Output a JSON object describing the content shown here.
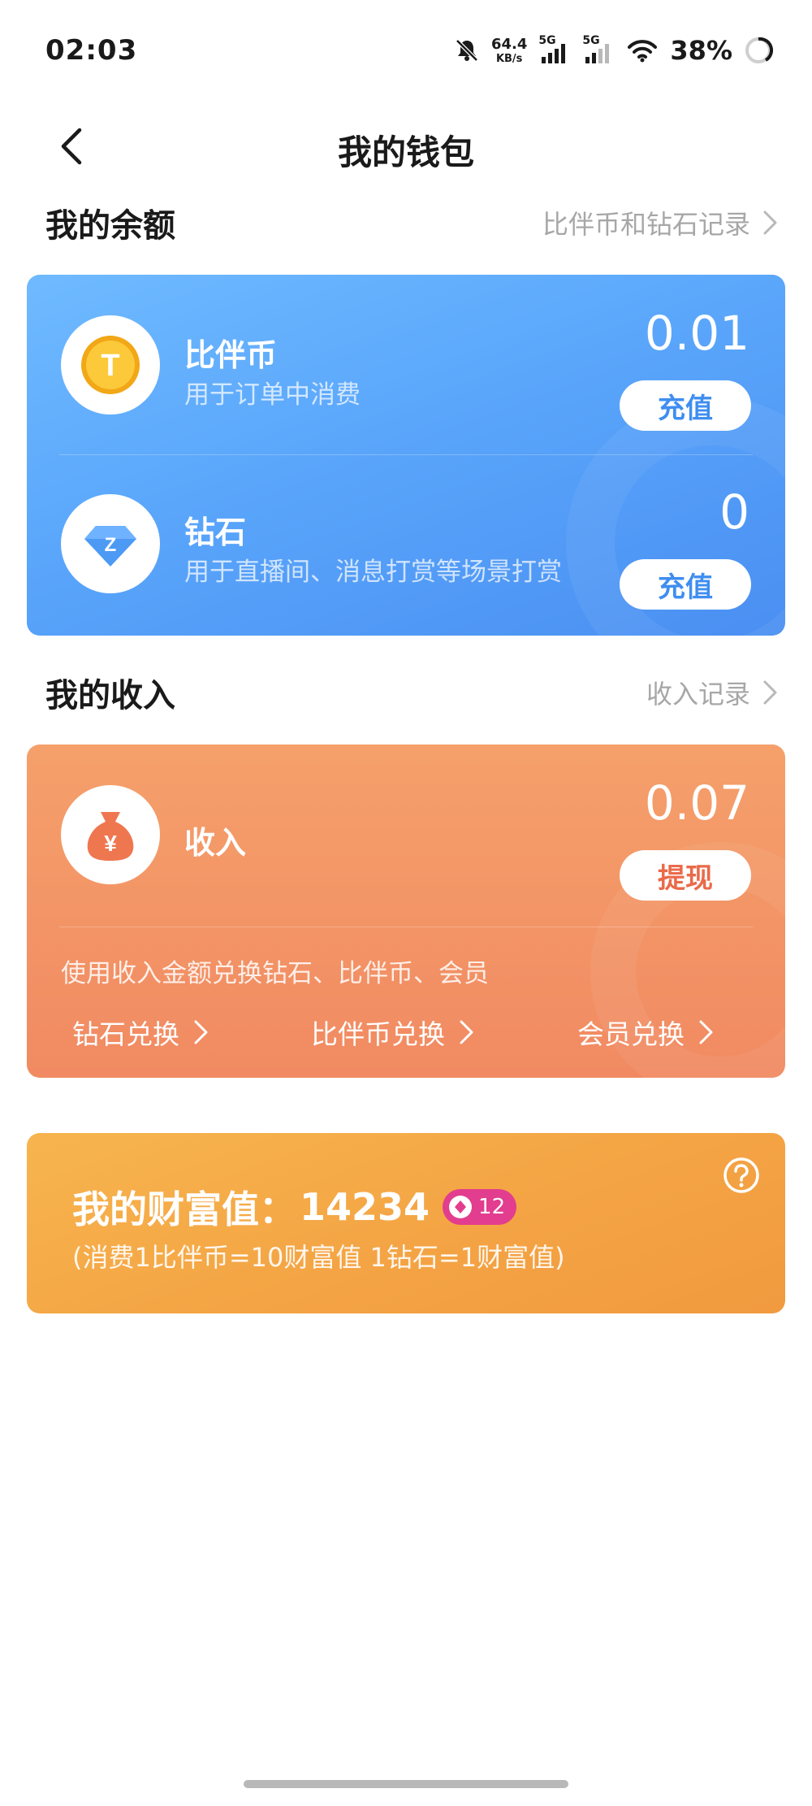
{
  "status_bar": {
    "time": "02:03",
    "net_speed_value": "64.4",
    "net_speed_unit": "KB/s",
    "signal1_label": "5G",
    "signal2_label": "5G",
    "battery": "38%"
  },
  "header": {
    "title": "我的钱包"
  },
  "balance": {
    "section_title": "我的余额",
    "records_link": "比伴币和钻石记录",
    "coin": {
      "title": "比伴币",
      "subtitle": "用于订单中消费",
      "amount": "0.01",
      "button": "充值",
      "icon_letter": "T"
    },
    "diamond": {
      "title": "钻石",
      "subtitle": "用于直播间、消息打赏等场景打赏",
      "amount": "0",
      "button": "充值",
      "icon_letter": "Z"
    }
  },
  "income": {
    "section_title": "我的收入",
    "records_link": "收入记录",
    "title": "收入",
    "amount": "0.07",
    "button": "提现",
    "icon_symbol": "¥",
    "description": "使用收入金额兑换钻石、比伴币、会员",
    "exchange_links": [
      "钻石兑换",
      "比伴币兑换",
      "会员兑换"
    ]
  },
  "wealth": {
    "label": "我的财富值：",
    "value": "14234",
    "level": "12",
    "note": "(消费1比伴币=10财富值 1钻石=1财富值)"
  },
  "colors": {
    "balance_card": "#5aa6fb",
    "income_card": "#f18a62",
    "wealth_card": "#f4a444",
    "recharge_text": "#3f8ef0",
    "withdraw_text": "#ea6a4a",
    "level_badge": "#e23d8e"
  }
}
